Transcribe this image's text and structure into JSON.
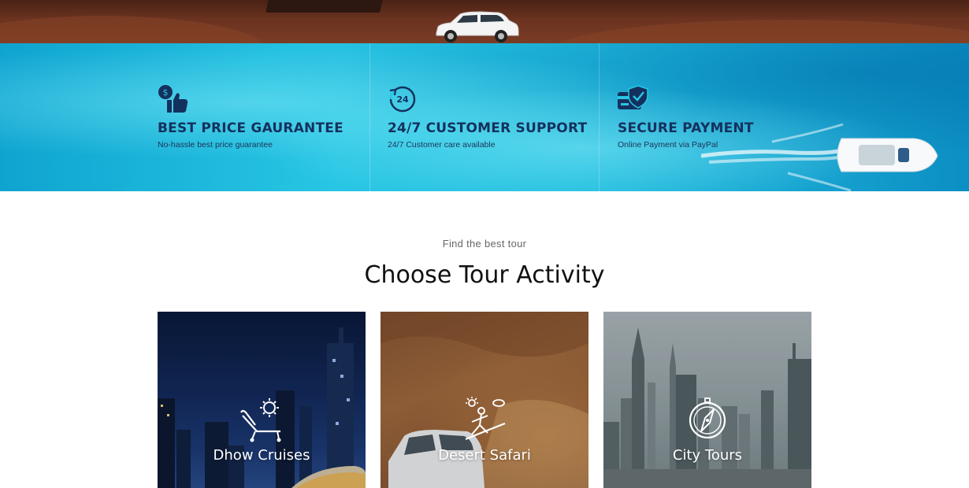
{
  "features": [
    {
      "icon": "price-tag-thumbs-up-icon",
      "title": "BEST PRICE GAURANTEE",
      "subtitle": "No-hassle best price guarantee"
    },
    {
      "icon": "support-24-7-icon",
      "title": "24/7 CUSTOMER SUPPORT",
      "subtitle": "24/7 Customer care available"
    },
    {
      "icon": "secure-card-shield-icon",
      "title": "SECURE PAYMENT",
      "subtitle": "Online Payment via PayPal"
    }
  ],
  "section": {
    "eyebrow": "Find the best tour",
    "title": "Choose Tour Activity"
  },
  "activities": [
    {
      "icon": "sunbed-icon",
      "label": "Dhow Cruises"
    },
    {
      "icon": "sandboarding-icon",
      "label": "Desert Safari"
    },
    {
      "icon": "compass-icon",
      "label": "City Tours"
    }
  ],
  "colors": {
    "feature_text": "#14315e",
    "ocean": "#28c6e4",
    "heading": "#111111"
  }
}
